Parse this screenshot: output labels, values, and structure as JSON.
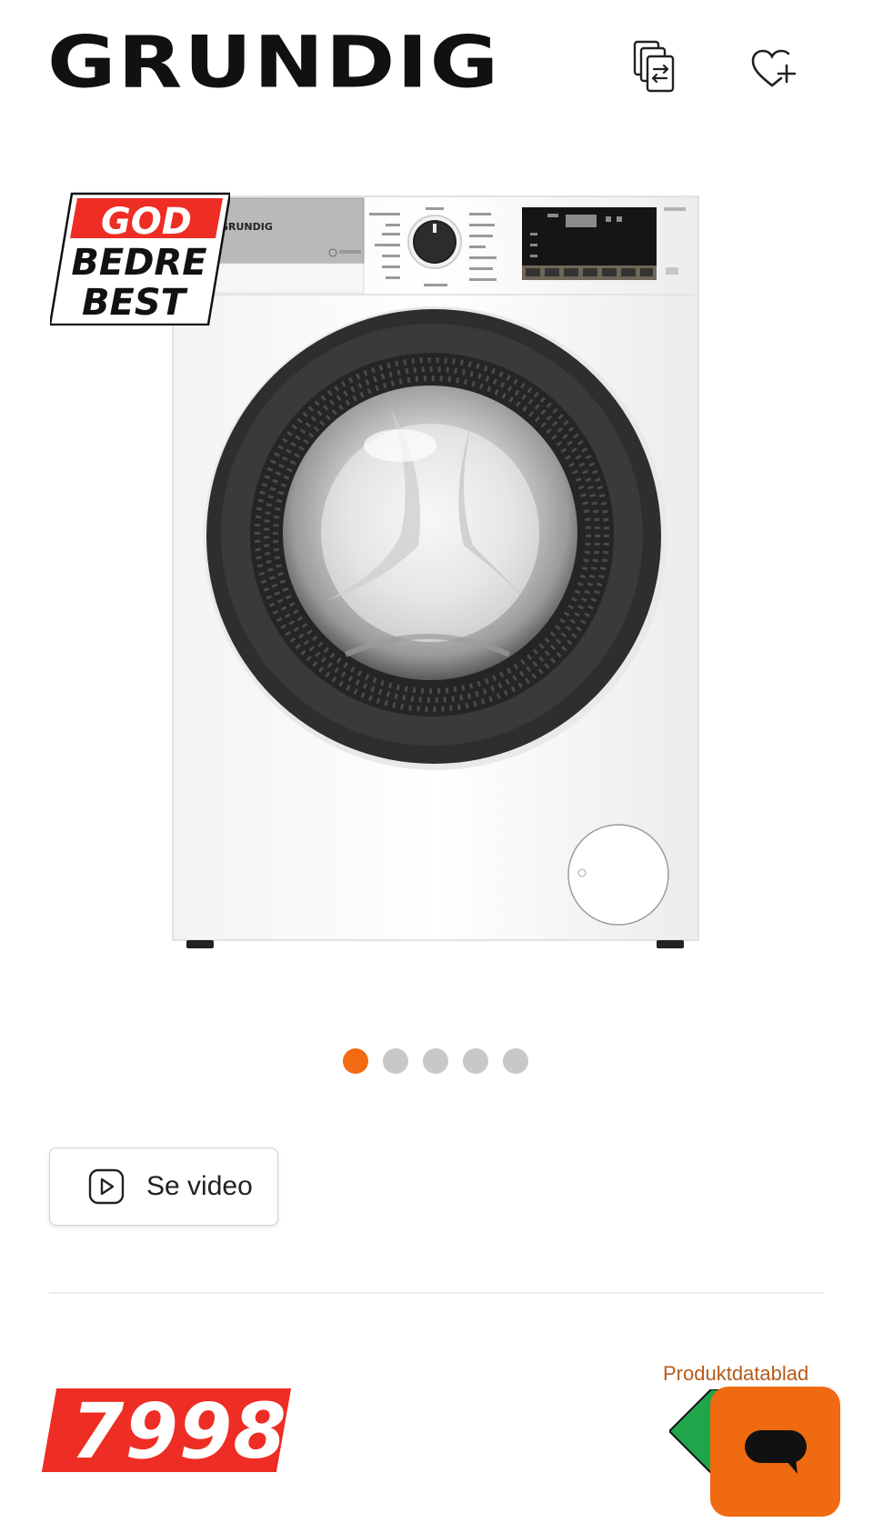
{
  "header": {
    "brand": "GRUNDIG",
    "compare_icon": "compare-icon",
    "wishlist_icon": "heart-plus-icon"
  },
  "product": {
    "image_alt": "washing-machine-image",
    "machine_brand": "GRUNDIG",
    "badge": {
      "line1": "GOD",
      "line2": "BEDRE",
      "line3": "BEST"
    }
  },
  "gallery": {
    "total_images": 5,
    "active_index": 0
  },
  "video": {
    "label": "Se video",
    "icon": "play-icon"
  },
  "pricing": {
    "price": "7998",
    "datasheet_link": "Produktdatablad"
  },
  "chat": {
    "icon": "chat-bubble-icon"
  },
  "colors": {
    "accent": "#f26a12",
    "price_red": "#ee2d24",
    "link": "#b65a1c",
    "energy_green": "#1fa54b"
  }
}
